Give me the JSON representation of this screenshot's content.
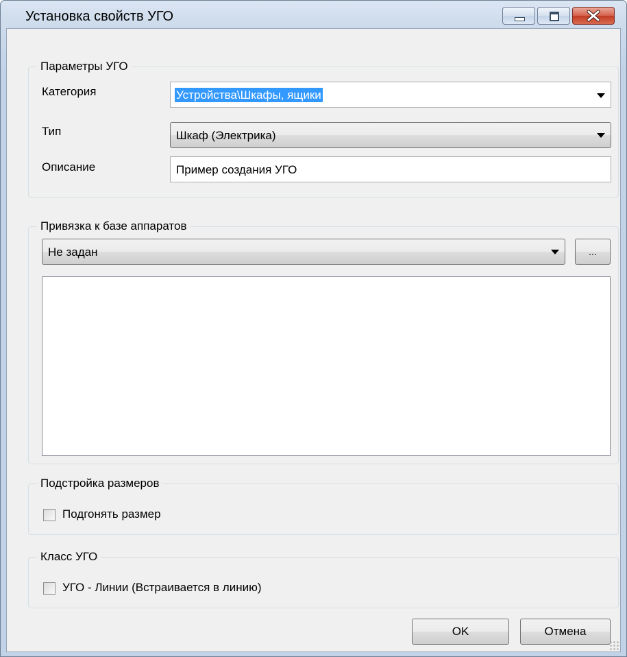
{
  "window": {
    "title": "Установка свойств УГО",
    "controls": {
      "minimize_icon": "minimize-icon",
      "maximize_icon": "maximize-icon",
      "close_icon": "close-icon"
    }
  },
  "params_group": {
    "legend": "Параметры УГО",
    "category": {
      "label": "Категория",
      "value": "Устройства\\Шкафы, ящики"
    },
    "type": {
      "label": "Тип",
      "value": "Шкаф (Электрика)"
    },
    "description": {
      "label": "Описание",
      "value": "Пример создания УГО"
    }
  },
  "binding_group": {
    "legend": "Привязка к базе аппаратов",
    "selected": "Не задан",
    "browse_label": "..."
  },
  "size_group": {
    "legend": "Подстройка размеров",
    "fit_size": {
      "label": "Подгонять размер",
      "checked": false
    }
  },
  "class_group": {
    "legend": "Класс УГО",
    "line_ugo": {
      "label": "УГО - Линии (Встраивается в линию)",
      "checked": false
    }
  },
  "buttons": {
    "ok": "OK",
    "cancel": "Отмена"
  },
  "colors": {
    "selection": "#3399ff",
    "dialog_bg": "#f0f0f0",
    "close_button": "#c23b23"
  }
}
